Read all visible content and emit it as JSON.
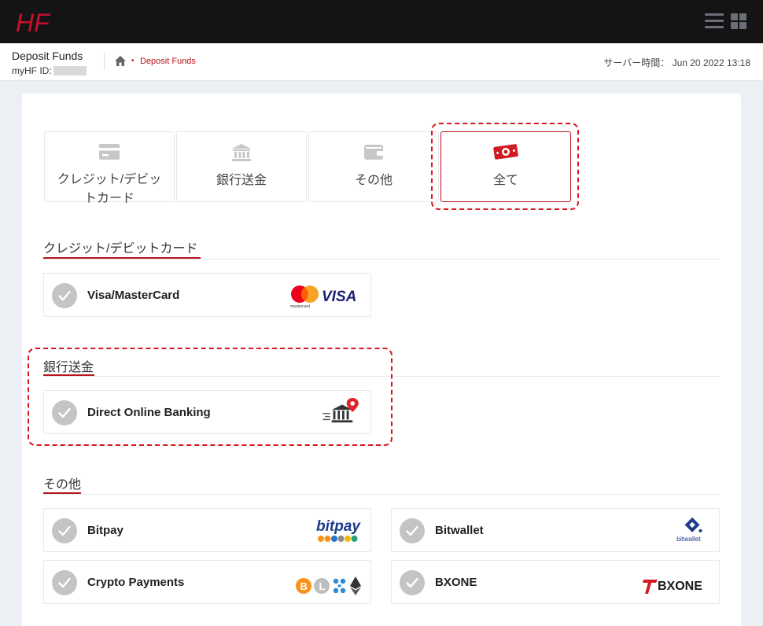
{
  "header": {
    "logo_text": "HF"
  },
  "subheader": {
    "page_title": "Deposit Funds",
    "myhf_label": "myHF ID:",
    "breadcrumb_current": "Deposit Funds",
    "server_time_label": "サーバー時間：",
    "server_time_value": "Jun 20 2022 13:18"
  },
  "tabs": [
    {
      "label": "クレジット/デビットカード",
      "icon": "credit-card-icon",
      "active": false
    },
    {
      "label": "銀行送金",
      "icon": "bank-icon",
      "active": false
    },
    {
      "label": "その他",
      "icon": "wallet-icon",
      "active": false
    },
    {
      "label": "全て",
      "icon": "money-icon",
      "active": true
    }
  ],
  "sections": {
    "cards": {
      "title": "クレジット/デビットカード",
      "methods": [
        {
          "name": "Visa/MasterCard",
          "logo": "visa-mastercard-logo",
          "logo_text": "VISA",
          "logo_subtext": "mastercard"
        }
      ]
    },
    "bank": {
      "title": "銀行送金",
      "methods": [
        {
          "name": "Direct Online Banking",
          "logo": "online-banking-logo"
        }
      ]
    },
    "other": {
      "title": "その他",
      "methods": [
        {
          "name": "Bitpay",
          "logo": "bitpay-logo",
          "logo_text": "bitpay"
        },
        {
          "name": "Bitwallet",
          "logo": "bitwallet-logo",
          "logo_text": "bitwallet"
        },
        {
          "name": "Crypto Payments",
          "logo": "crypto-logos"
        },
        {
          "name": "BXONE",
          "logo": "bxone-logo",
          "logo_text": "BXONE"
        }
      ]
    }
  },
  "colors": {
    "accent": "#b8141c",
    "highlight_dashed": "#d9161f",
    "topbar": "#141414",
    "check_circle": "#c4c4c4"
  }
}
